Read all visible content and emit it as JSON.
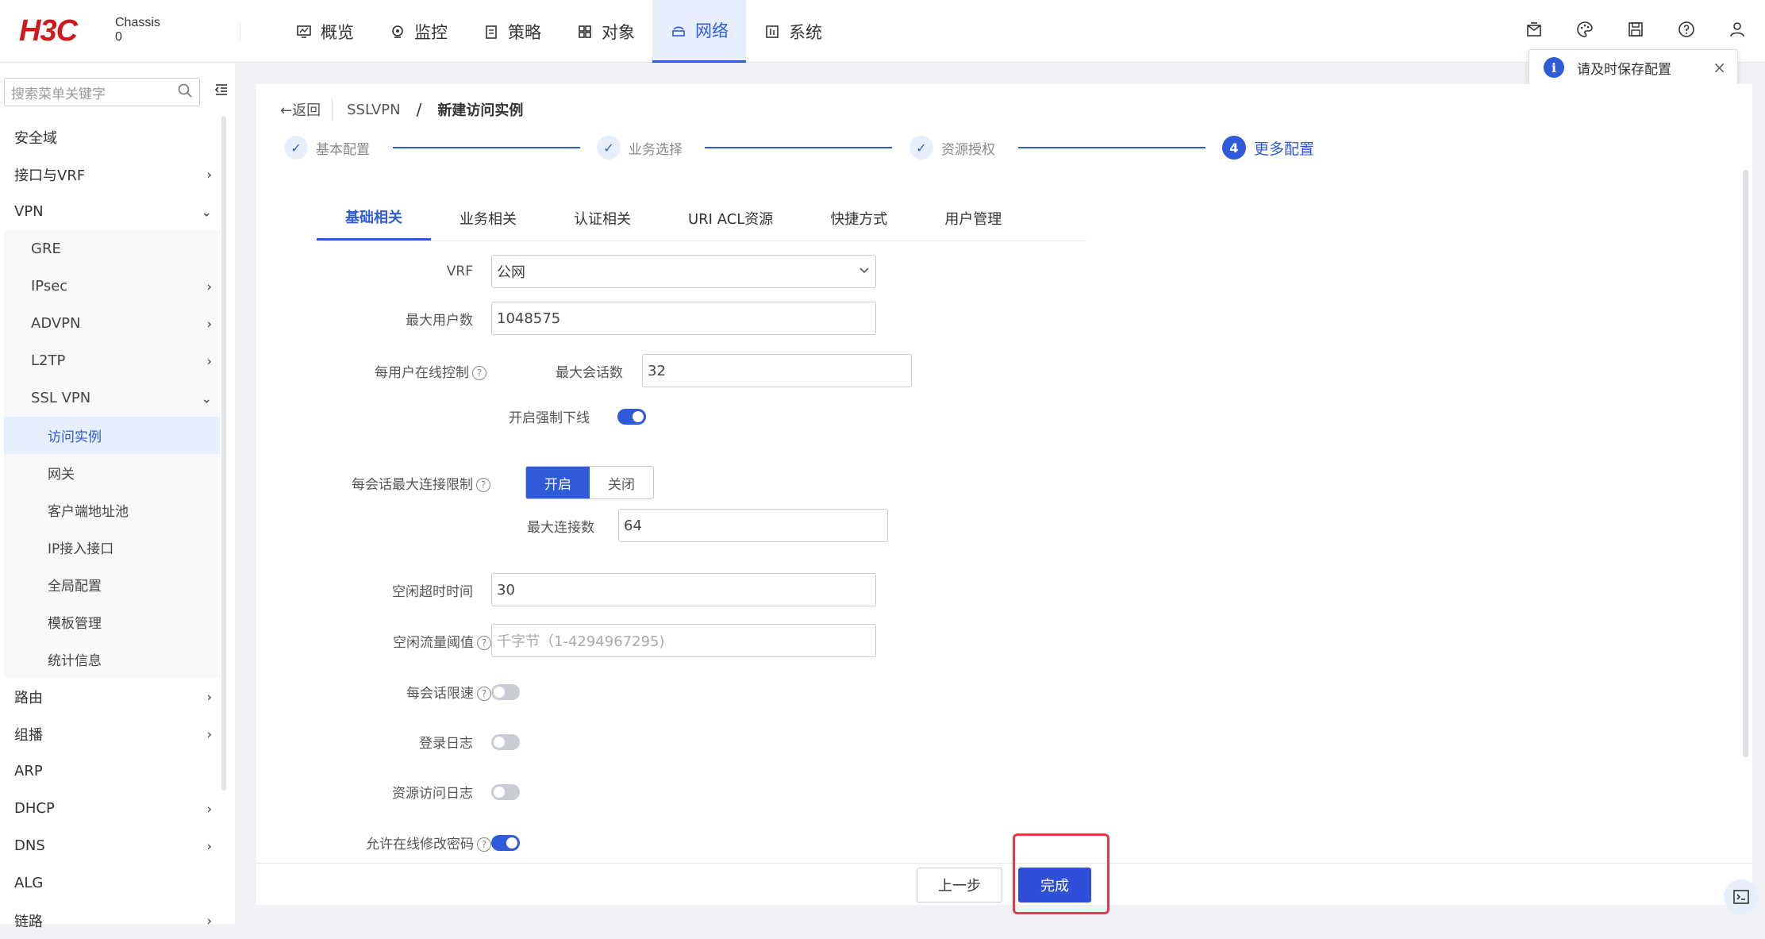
{
  "brand": {
    "logo": "H3C",
    "sub_line1": "Chassis",
    "sub_line2": "0"
  },
  "nav": [
    {
      "label": "概览",
      "icon": "overview-icon"
    },
    {
      "label": "监控",
      "icon": "monitor-icon"
    },
    {
      "label": "策略",
      "icon": "policy-icon"
    },
    {
      "label": "对象",
      "icon": "object-icon"
    },
    {
      "label": "网络",
      "icon": "network-icon",
      "active": true
    },
    {
      "label": "系统",
      "icon": "system-icon"
    }
  ],
  "notice": {
    "text": "请及时保存配置",
    "info": "i",
    "close": "×"
  },
  "sidebar": {
    "search_placeholder": "搜索菜单关键字",
    "items": [
      {
        "label": "安全域"
      },
      {
        "label": "接口与VRF",
        "chev": "›"
      },
      {
        "label": "VPN",
        "chev": "⌄"
      },
      {
        "label": "GRE"
      },
      {
        "label": "IPsec",
        "chev": "›"
      },
      {
        "label": "ADVPN",
        "chev": "›"
      },
      {
        "label": "L2TP",
        "chev": "›"
      },
      {
        "label": "SSL VPN",
        "chev": "⌄"
      },
      {
        "label": "访问实例"
      },
      {
        "label": "网关"
      },
      {
        "label": "客户端地址池"
      },
      {
        "label": "IP接入接口"
      },
      {
        "label": "全局配置"
      },
      {
        "label": "模板管理"
      },
      {
        "label": "统计信息"
      },
      {
        "label": "路由",
        "chev": "›"
      },
      {
        "label": "组播",
        "chev": "›"
      },
      {
        "label": "ARP"
      },
      {
        "label": "DHCP",
        "chev": "›"
      },
      {
        "label": "DNS",
        "chev": "›"
      },
      {
        "label": "ALG"
      },
      {
        "label": "链路",
        "chev": "›"
      }
    ]
  },
  "breadcrumb": {
    "back": "←返回",
    "parent": "SSLVPN",
    "sep": "/",
    "current": "新建访问实例"
  },
  "steps": [
    {
      "label": "基本配置",
      "mark": "✓"
    },
    {
      "label": "业务选择",
      "mark": "✓"
    },
    {
      "label": "资源授权",
      "mark": "✓"
    },
    {
      "label": "更多配置",
      "mark": "4"
    }
  ],
  "tabs": [
    "基础相关",
    "业务相关",
    "认证相关",
    "URI ACL资源",
    "快捷方式",
    "用户管理"
  ],
  "form": {
    "vrf_label": "VRF",
    "vrf_value": "公网",
    "max_users_label": "最大用户数",
    "max_users_value": "1048575",
    "per_user_label": "每用户在线控制",
    "max_sessions_label": "最大会话数",
    "max_sessions_value": "32",
    "force_offline_label": "开启强制下线",
    "per_session_conn_label": "每会话最大连接限制",
    "seg_on": "开启",
    "seg_off": "关闭",
    "max_conn_label": "最大连接数",
    "max_conn_value": "64",
    "idle_timeout_label": "空闲超时时间",
    "idle_timeout_value": "30",
    "idle_traffic_label": "空闲流量阈值",
    "idle_traffic_placeholder": "千字节（1-4294967295)",
    "session_rate_label": "每会话限速",
    "login_log_label": "登录日志",
    "resource_log_label": "资源访问日志",
    "allow_pwd_label": "允许在线修改密码",
    "help": "?"
  },
  "footer": {
    "prev": "上一步",
    "done": "完成"
  }
}
